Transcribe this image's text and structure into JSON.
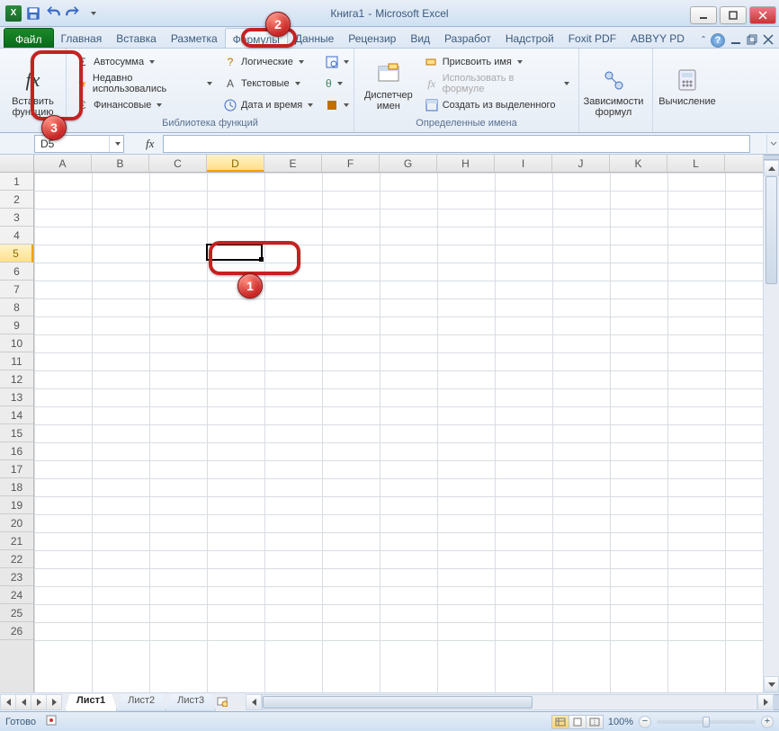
{
  "window": {
    "doc_title": "Книга1",
    "app_title": "Microsoft Excel"
  },
  "tabs": {
    "file": "Файл",
    "items": [
      "Главная",
      "Вставка",
      "Разметка",
      "Формулы",
      "Данные",
      "Рецензир",
      "Вид",
      "Разработ",
      "Надстрой",
      "Foxit PDF",
      "ABBYY PD"
    ],
    "active_index": 3
  },
  "ribbon": {
    "insert_fn": {
      "label_line1": "Вставить",
      "label_line2": "функцию",
      "icon": "fx"
    },
    "lib": {
      "autosum": "Автосумма",
      "recent": "Недавно использовались",
      "financial": "Финансовые",
      "logical": "Логические",
      "text": "Текстовые",
      "datetime": "Дата и время",
      "group_label": "Библиотека функций"
    },
    "name_mgr": {
      "label_line1": "Диспетчер",
      "label_line2": "имен"
    },
    "names": {
      "assign": "Присвоить имя",
      "use_in_formula": "Использовать в формуле",
      "create_from_sel": "Создать из выделенного",
      "group_label": "Определенные имена"
    },
    "audit": {
      "label_line1": "Зависимости",
      "label_line2": "формул"
    },
    "calc": {
      "label": "Вычисление"
    }
  },
  "formula_bar": {
    "namebox_value": "D5",
    "fx_label": "fx",
    "formula_value": ""
  },
  "grid": {
    "columns": [
      "A",
      "B",
      "C",
      "D",
      "E",
      "F",
      "G",
      "H",
      "I",
      "J",
      "K",
      "L"
    ],
    "row_count": 26,
    "selected_cell": "D5",
    "selected_col_index": 3,
    "selected_row_index": 4
  },
  "sheets": {
    "items": [
      "Лист1",
      "Лист2",
      "Лист3"
    ],
    "active_index": 0
  },
  "status": {
    "ready": "Готово",
    "zoom": "100%"
  },
  "callouts": {
    "b1": "1",
    "b2": "2",
    "b3": "3"
  }
}
